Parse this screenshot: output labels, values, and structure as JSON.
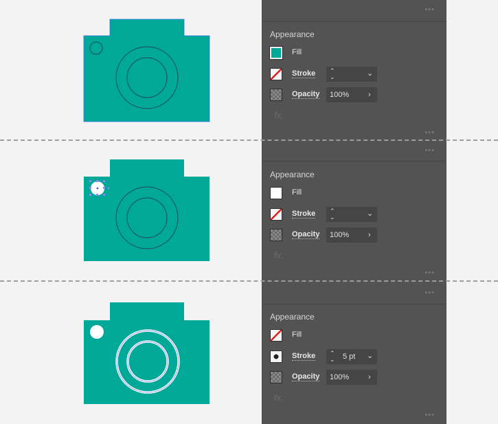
{
  "colors": {
    "teal": "#00a897",
    "panel": "#535353",
    "lens_stroke": "#1f4a5e"
  },
  "sections": [
    {
      "title": "Appearance",
      "fill_label": "Fill",
      "fill_state": "teal",
      "stroke_label": "Stroke",
      "stroke_state": "none",
      "stroke_value": "",
      "opacity_label": "Opacity",
      "opacity_value": "100%",
      "fx": "fx."
    },
    {
      "title": "Appearance",
      "fill_label": "Fill",
      "fill_state": "white",
      "stroke_label": "Stroke",
      "stroke_state": "none",
      "stroke_value": "",
      "opacity_label": "Opacity",
      "opacity_value": "100%",
      "fx": "fx."
    },
    {
      "title": "Appearance",
      "fill_label": "Fill",
      "fill_state": "none",
      "stroke_label": "Stroke",
      "stroke_state": "white",
      "stroke_value": "5 pt",
      "opacity_label": "Opacity",
      "opacity_value": "100%",
      "fx": "fx."
    }
  ]
}
